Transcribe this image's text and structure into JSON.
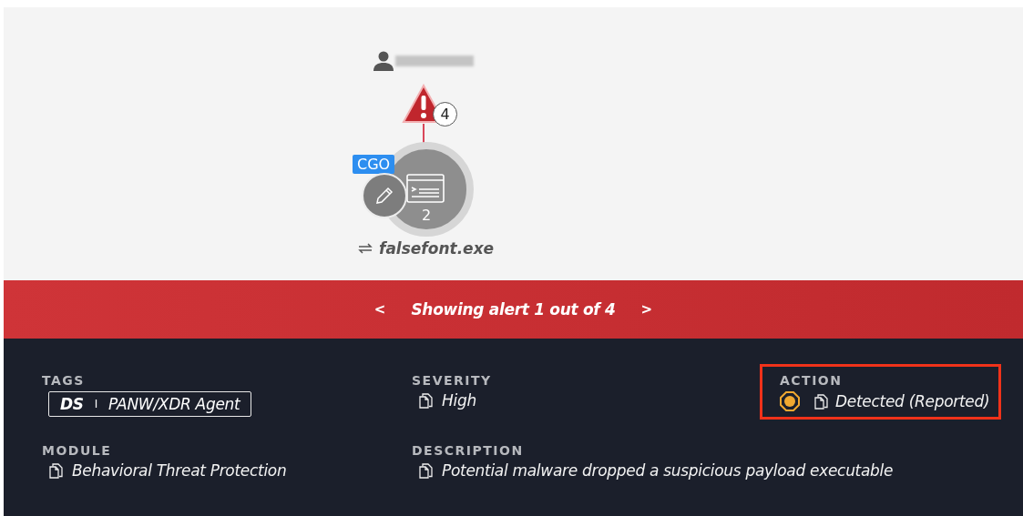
{
  "graph": {
    "alert_count": "4",
    "tag": "CGO",
    "process_count": "2",
    "process_name": "falsefont.exe"
  },
  "alert_nav": {
    "prev": "<",
    "text": "Showing alert 1 out of 4",
    "next": ">"
  },
  "fields": [
    {
      "kind": "tag",
      "label": "TAGS",
      "prefix": "DS",
      "separator": "I",
      "value": "PANW/XDR Agent"
    },
    {
      "kind": "text",
      "label": "SEVERITY",
      "value": "High"
    },
    {
      "kind": "action",
      "label": "ACTION",
      "value": "Detected (Reported)",
      "color": "#f0a830",
      "highlighted": true
    },
    {
      "kind": "text",
      "label": "MODULE",
      "value": "Behavioral Threat Protection"
    },
    {
      "kind": "text",
      "label": "DESCRIPTION",
      "value": "Potential malware dropped a suspicious payload executable"
    }
  ]
}
